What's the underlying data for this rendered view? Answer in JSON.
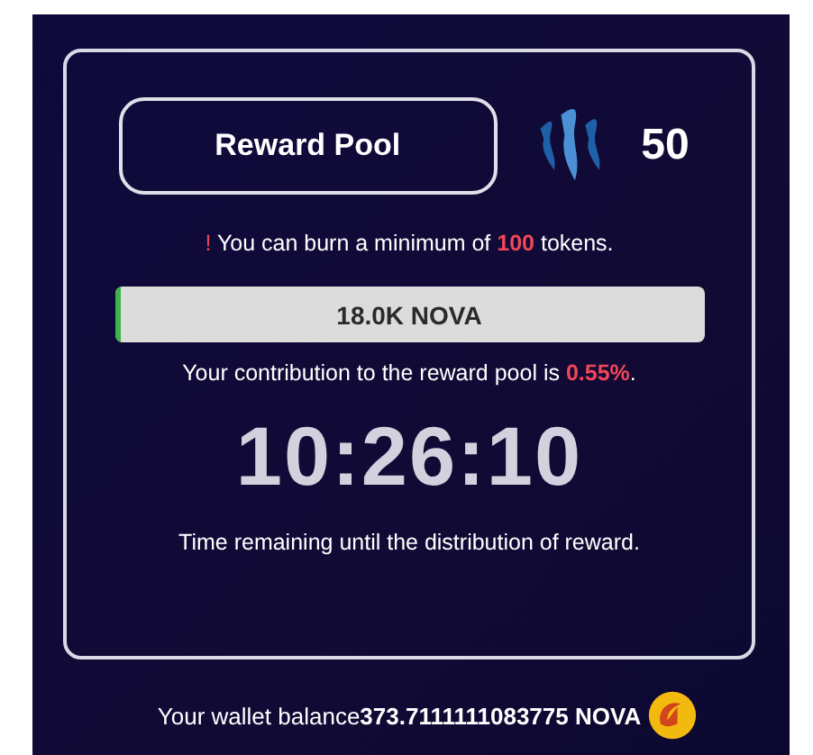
{
  "pool_button": {
    "label": "Reward Pool"
  },
  "burn_amount": "50",
  "notice": {
    "mark": "!",
    "before": "You can burn a minimum of",
    "amount": "100",
    "after": "tokens."
  },
  "pool_bar": {
    "label": "18.0K NOVA",
    "level": 0.01
  },
  "contribution": {
    "before": "Your contribution to the reward pool is",
    "percent": "0.55%",
    "after": "."
  },
  "countdown": "10:26:10",
  "countdown_caption": "Time remaining until the distribution of reward.",
  "wallet": "Your wallet balance**373.7111111083775 NOVA**"
}
